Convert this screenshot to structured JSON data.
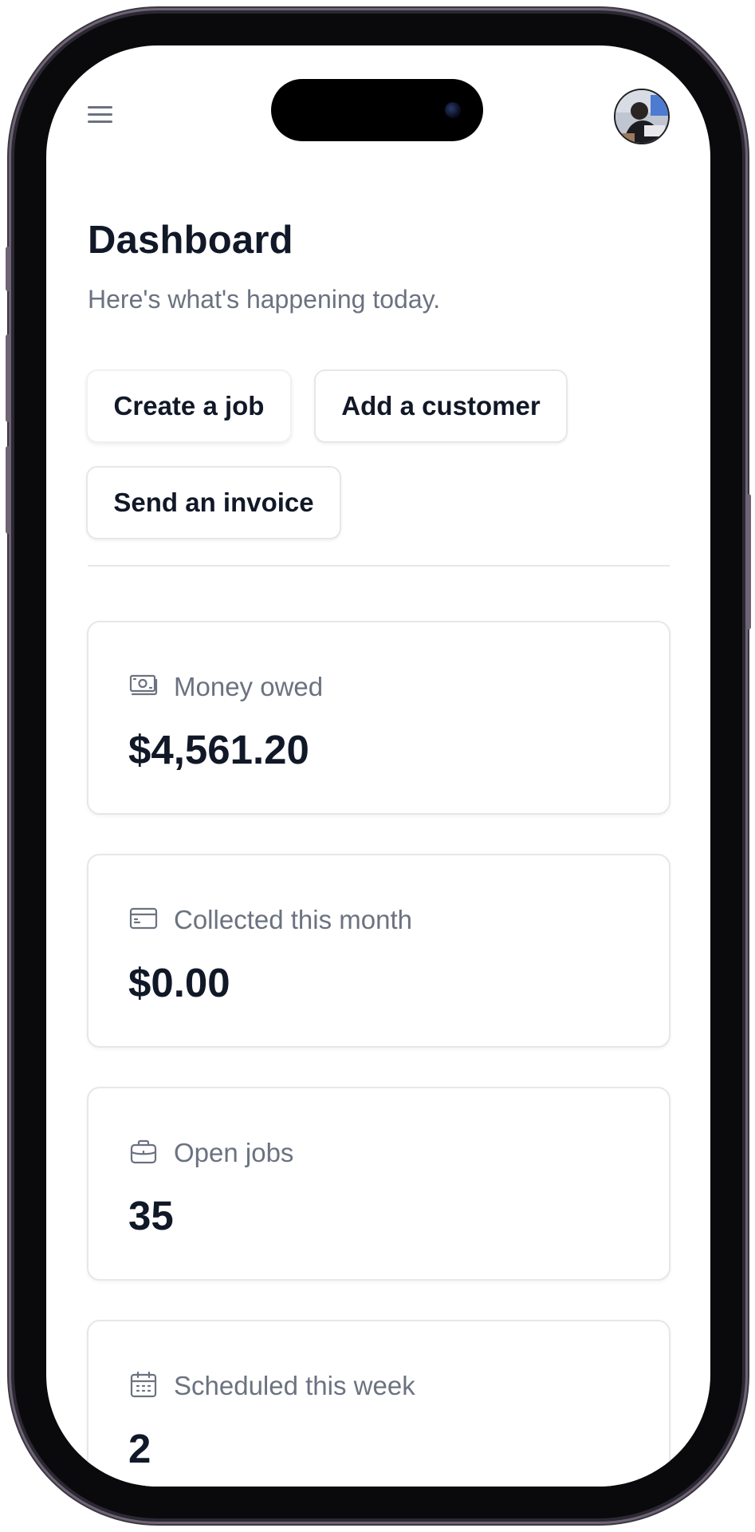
{
  "header": {
    "menu_icon": "hamburger-menu-icon",
    "avatar_icon": "user-avatar"
  },
  "page": {
    "title": "Dashboard",
    "subtitle": "Here's what's happening today."
  },
  "actions": {
    "create_job": "Create a job",
    "add_customer": "Add a customer",
    "send_invoice": "Send an invoice"
  },
  "stats": [
    {
      "icon": "banknote-icon",
      "label": "Money owed",
      "value": "$4,561.20"
    },
    {
      "icon": "credit-card-icon",
      "label": "Collected this month",
      "value": "$0.00"
    },
    {
      "icon": "briefcase-icon",
      "label": "Open jobs",
      "value": "35"
    },
    {
      "icon": "calendar-icon",
      "label": "Scheduled this week",
      "value": "2"
    }
  ],
  "colors": {
    "text_primary": "#111827",
    "text_secondary": "#6b7280",
    "border": "#e5e7eb",
    "phone_frame": "#0a0a0c"
  }
}
